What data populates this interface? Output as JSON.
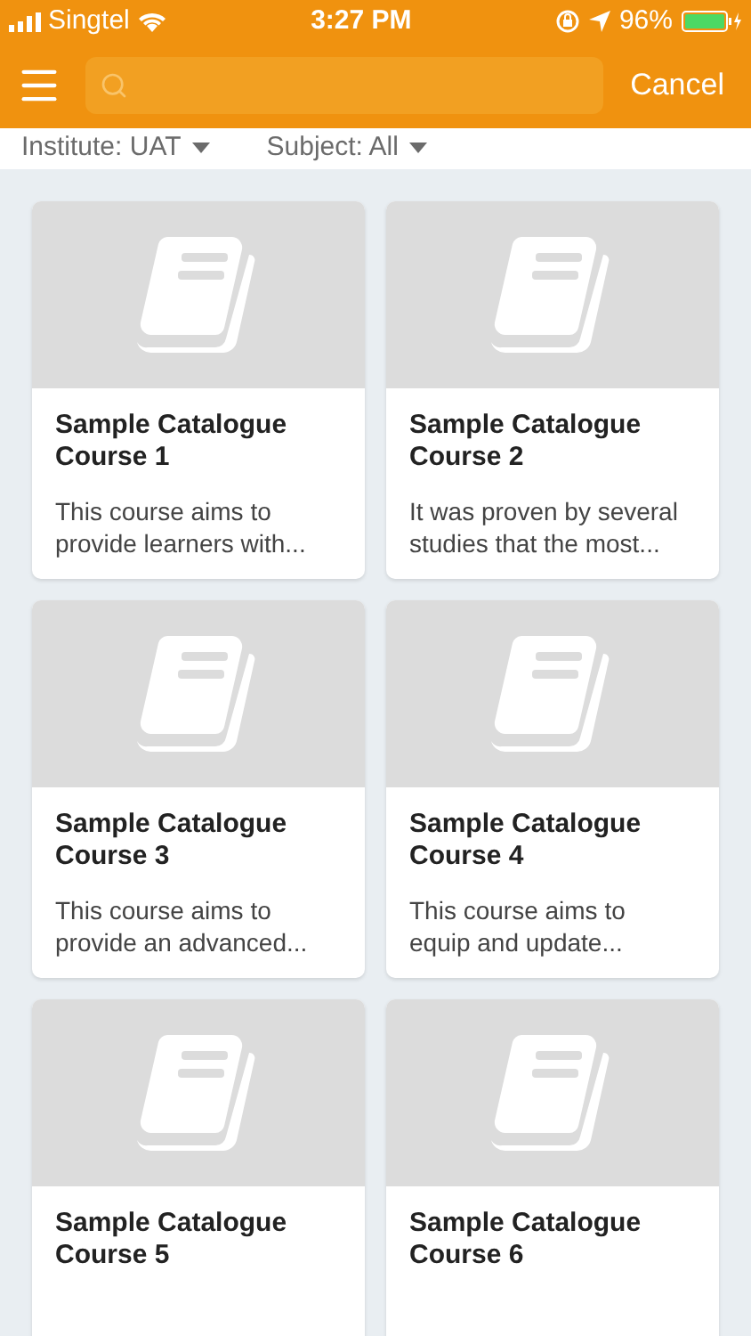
{
  "status_bar": {
    "carrier": "Singtel",
    "time": "3:27 PM",
    "battery_percent": "96%"
  },
  "header": {
    "cancel": "Cancel"
  },
  "filters": [
    {
      "label": "Institute: UAT"
    },
    {
      "label": "Subject: All"
    }
  ],
  "courses": [
    {
      "title": "Sample Catalogue Course 1",
      "description": "This course aims to provide learners with..."
    },
    {
      "title": "Sample Catalogue Course 2",
      "description": "It was proven by several studies that the most..."
    },
    {
      "title": "Sample Catalogue Course 3",
      "description": "This course aims to provide an advanced..."
    },
    {
      "title": "Sample Catalogue Course 4",
      "description": "This course aims to equip and update..."
    },
    {
      "title": "Sample Catalogue Course 5"
    },
    {
      "title": "Sample Catalogue Course 6"
    }
  ]
}
